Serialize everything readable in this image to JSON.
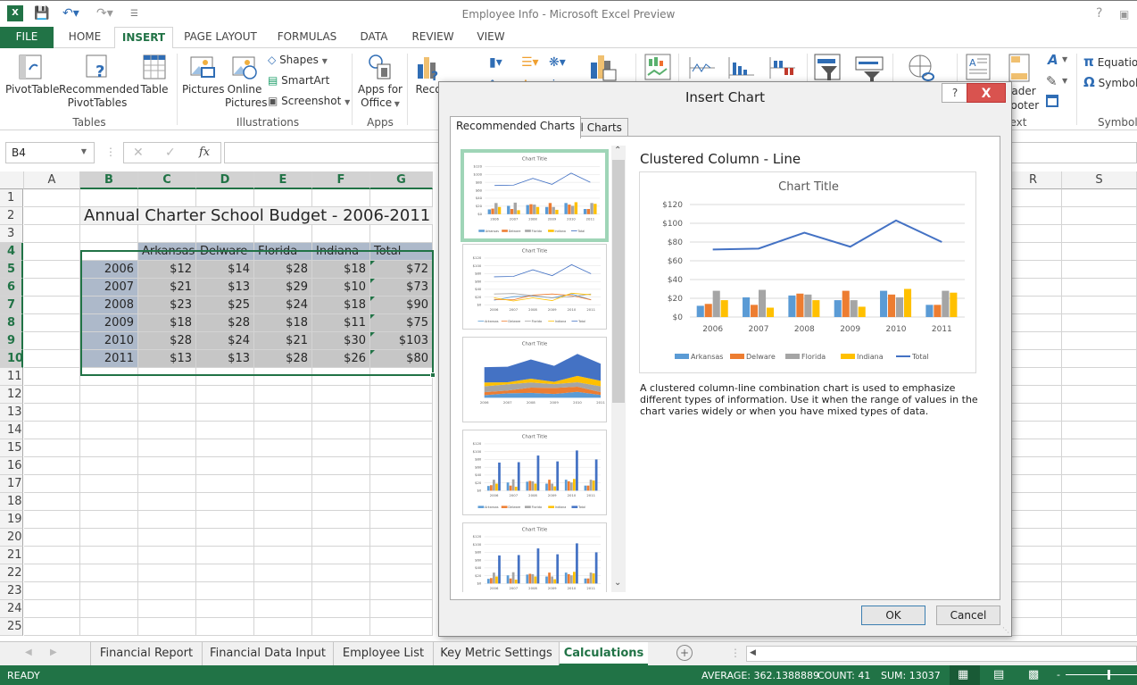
{
  "window": {
    "title": "Employee Info - Microsoft Excel Preview",
    "help_icon": "?",
    "restore_icon": "restore"
  },
  "quick_access": [
    "excel-logo",
    "save",
    "undo",
    "redo",
    "customize"
  ],
  "ribbon_tabs": [
    {
      "label": "FILE"
    },
    {
      "label": "HOME"
    },
    {
      "label": "INSERT",
      "active": true
    },
    {
      "label": "PAGE LAYOUT"
    },
    {
      "label": "FORMULAS"
    },
    {
      "label": "DATA"
    },
    {
      "label": "REVIEW"
    },
    {
      "label": "VIEW"
    }
  ],
  "ribbon": {
    "tables": {
      "label": "Tables",
      "pivottable": "PivotTable",
      "recommended_1": "Recommended",
      "recommended_2": "PivotTables",
      "table": "Table"
    },
    "illustrations": {
      "label": "Illustrations",
      "pictures": "Pictures",
      "online_1": "Online",
      "online_2": "Pictures",
      "shapes": "Shapes",
      "smartart": "SmartArt",
      "screenshot": "Screenshot"
    },
    "apps": {
      "label": "Apps",
      "apps_1": "Apps for",
      "apps_2": "Office"
    },
    "charts": {
      "recommended_partial": "Reco"
    },
    "text": {
      "label_partial": "ext",
      "header_1": "eader",
      "header_2": "Footer"
    },
    "symbols": {
      "label": "Symbols",
      "equation": "Equatio",
      "symbol": "Symbol"
    }
  },
  "formula_bar": {
    "name_box": "B4",
    "fx": "fx",
    "value": ""
  },
  "sheet": {
    "columns": [
      "A",
      "B",
      "C",
      "D",
      "E",
      "F",
      "G",
      "R",
      "S"
    ],
    "rows": [
      "1",
      "2",
      "3",
      "4",
      "5",
      "6",
      "7",
      "8",
      "9",
      "10",
      "11",
      "12",
      "13",
      "14",
      "15",
      "16",
      "17",
      "18",
      "19",
      "20",
      "21",
      "22",
      "23",
      "24",
      "25"
    ],
    "title": "Annual Charter School Budget - 2006-2011",
    "table": {
      "headers": [
        "",
        "Arkansas",
        "Delware",
        "Florida",
        "Indiana",
        "Total"
      ],
      "rows": [
        [
          "2006",
          "$12",
          "$14",
          "$28",
          "$18",
          "$72"
        ],
        [
          "2007",
          "$21",
          "$13",
          "$29",
          "$10",
          "$73"
        ],
        [
          "2008",
          "$23",
          "$25",
          "$24",
          "$18",
          "$90"
        ],
        [
          "2009",
          "$18",
          "$28",
          "$18",
          "$11",
          "$75"
        ],
        [
          "2010",
          "$28",
          "$24",
          "$21",
          "$30",
          "$103"
        ],
        [
          "2011",
          "$13",
          "$13",
          "$28",
          "$26",
          "$80"
        ]
      ]
    }
  },
  "dialog": {
    "title": "Insert Chart",
    "help": "?",
    "close": "X",
    "tabs": [
      "Recommended Charts",
      "All Charts"
    ],
    "selected_chart_name": "Clustered Column - Line",
    "description": "A clustered column-line combination chart is used to emphasize different types of information. Use it when the range of values in the chart varies widely or when you have mixed types of data.",
    "ok": "OK",
    "cancel": "Cancel",
    "thumbnails": [
      {
        "type": "clustered-column-line",
        "title": "Chart Title",
        "selected": true
      },
      {
        "type": "line",
        "title": "Chart Title"
      },
      {
        "type": "stacked-area",
        "title": "Chart Title"
      },
      {
        "type": "clustered-column",
        "title": "Chart Title"
      },
      {
        "type": "clustered-column-by-series",
        "title": "Chart Title"
      }
    ]
  },
  "chart_data": {
    "type": "bar",
    "title": "Chart Title",
    "categories": [
      "2006",
      "2007",
      "2008",
      "2009",
      "2010",
      "2011"
    ],
    "series": [
      {
        "name": "Arkansas",
        "kind": "column",
        "color": "#5b9bd5",
        "values": [
          12,
          21,
          23,
          18,
          28,
          13
        ]
      },
      {
        "name": "Delware",
        "kind": "column",
        "color": "#ed7d31",
        "values": [
          14,
          13,
          25,
          28,
          24,
          13
        ]
      },
      {
        "name": "Florida",
        "kind": "column",
        "color": "#a5a5a5",
        "values": [
          28,
          29,
          24,
          18,
          21,
          28
        ]
      },
      {
        "name": "Indiana",
        "kind": "column",
        "color": "#ffc000",
        "values": [
          18,
          10,
          18,
          11,
          30,
          26
        ]
      },
      {
        "name": "Total",
        "kind": "line",
        "color": "#4472c4",
        "values": [
          72,
          73,
          90,
          75,
          103,
          80
        ]
      }
    ],
    "yticks": [
      "$0",
      "$20",
      "$40",
      "$60",
      "$80",
      "$100",
      "$120"
    ],
    "ylim": [
      0,
      120
    ],
    "xlabel": "",
    "ylabel": "",
    "grid": true,
    "legend": "bottom"
  },
  "sheet_tabs": [
    "Financial Report",
    "Financial Data Input",
    "Employee List",
    "Key Metric Settings",
    "Calculations"
  ],
  "active_sheet": "Calculations",
  "status": {
    "ready": "READY",
    "average": "AVERAGE: 362.1388889",
    "count": "COUNT: 41",
    "sum": "SUM: 13037"
  },
  "colors": {
    "excel_green": "#217346",
    "selection_fill": "#c6c6c6",
    "header_fill": "#adb9ca"
  }
}
